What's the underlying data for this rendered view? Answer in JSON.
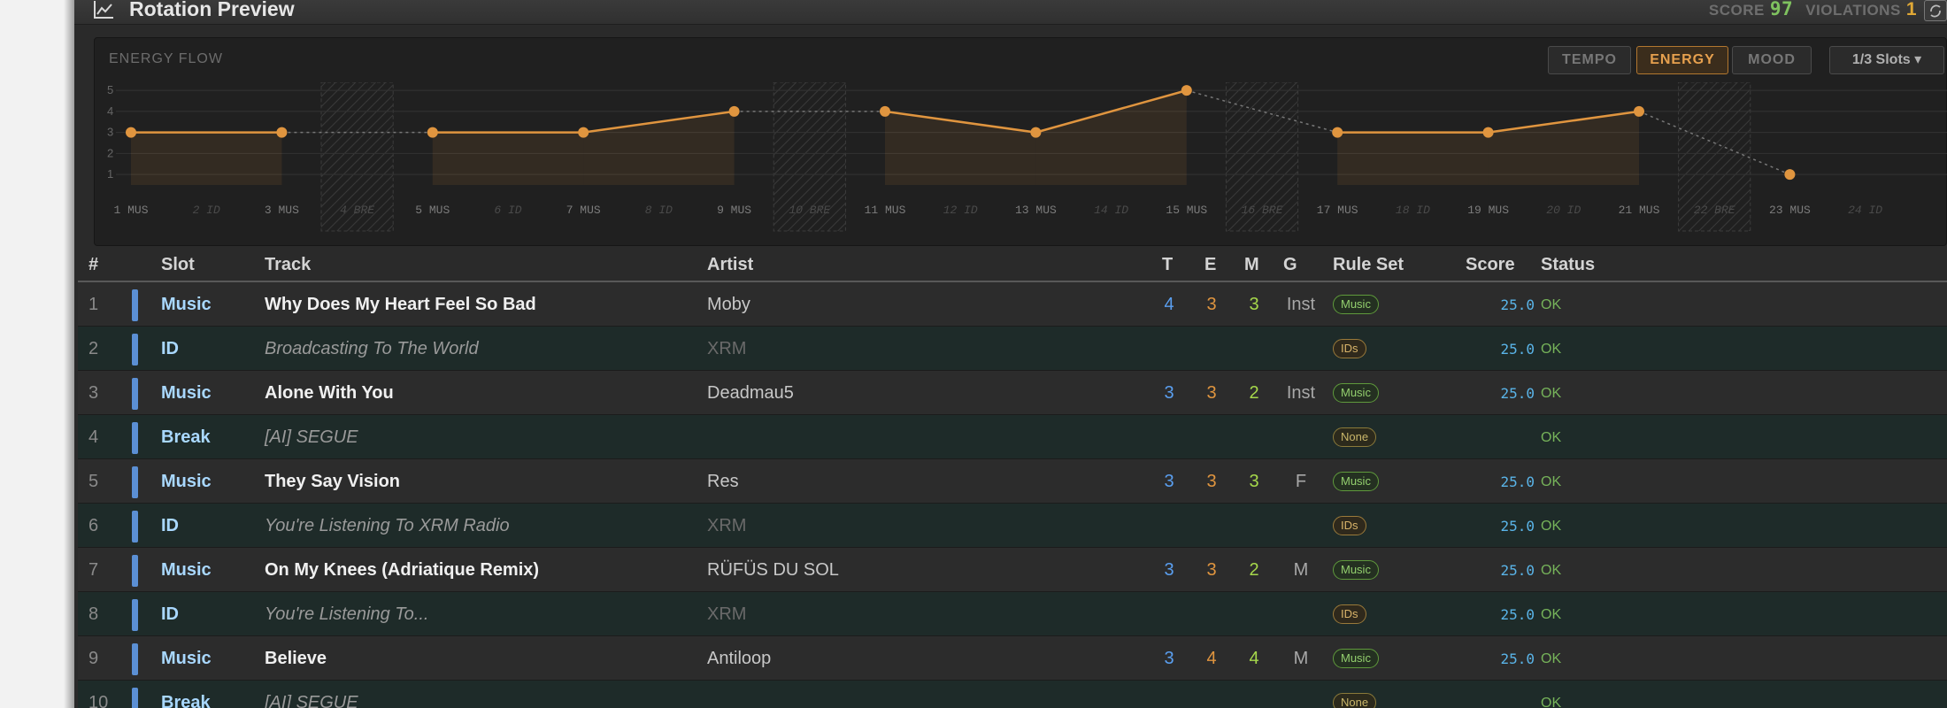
{
  "header": {
    "title": "Rotation Preview",
    "score_label": "SCORE",
    "score_value": "97",
    "violations_label": "VIOLATIONS",
    "violations_value": "1"
  },
  "chart_panel": {
    "label": "ENERGY FLOW",
    "toggles": [
      "TEMPO",
      "ENERGY",
      "MOOD"
    ],
    "active_toggle": "ENERGY",
    "slots_dropdown": "1/3 Slots ▾"
  },
  "chart_data": {
    "type": "line",
    "title": "",
    "xlabel": "",
    "ylabel": "",
    "ylim": [
      0.5,
      5.3
    ],
    "yticks": [
      1,
      2,
      3,
      4,
      5
    ],
    "grid": true,
    "x": [
      "1 MUS",
      "2 ID",
      "3 MUS",
      "4 BRE",
      "5 MUS",
      "6 ID",
      "7 MUS",
      "8 ID",
      "9 MUS",
      "10 BRE",
      "11 MUS",
      "12 ID",
      "13 MUS",
      "14 ID",
      "15 MUS",
      "16 BRE",
      "17 MUS",
      "18 ID",
      "19 MUS",
      "20 ID",
      "21 MUS",
      "22 BRE",
      "23 MUS",
      "24 ID"
    ],
    "series": [
      {
        "values": [
          3,
          null,
          3,
          null,
          3,
          null,
          3,
          null,
          4,
          null,
          4,
          null,
          3,
          null,
          5,
          null,
          3,
          null,
          3,
          null,
          4,
          null,
          1,
          null
        ]
      }
    ],
    "hatched_slots": [
      "4 BRE",
      "10 BRE",
      "16 BRE",
      "22 BRE"
    ],
    "line_color": "#e0953f"
  },
  "table": {
    "columns": [
      "#",
      "Slot",
      "Track",
      "Artist",
      "T",
      "E",
      "M",
      "G",
      "Rule Set",
      "Score",
      "Status"
    ],
    "rows": [
      {
        "n": "1",
        "slot": "Music",
        "track": "Why Does My Heart Feel So Bad",
        "artist": "Moby",
        "t": "4",
        "e": "3",
        "m": "3",
        "g": "Inst",
        "rule": "Music",
        "score": "25.0",
        "status": "OK"
      },
      {
        "n": "2",
        "slot": "ID",
        "track": "Broadcasting To The World",
        "artist": "XRM",
        "t": "",
        "e": "",
        "m": "",
        "g": "",
        "rule": "IDs",
        "score": "25.0",
        "status": "OK"
      },
      {
        "n": "3",
        "slot": "Music",
        "track": "Alone With You",
        "artist": "Deadmau5",
        "t": "3",
        "e": "3",
        "m": "2",
        "g": "Inst",
        "rule": "Music",
        "score": "25.0",
        "status": "OK"
      },
      {
        "n": "4",
        "slot": "Break",
        "track": "[AI] SEGUE",
        "artist": "",
        "t": "",
        "e": "",
        "m": "",
        "g": "",
        "rule": "None",
        "score": "",
        "status": "OK"
      },
      {
        "n": "5",
        "slot": "Music",
        "track": "They Say Vision",
        "artist": "Res",
        "t": "3",
        "e": "3",
        "m": "3",
        "g": "F",
        "rule": "Music",
        "score": "25.0",
        "status": "OK"
      },
      {
        "n": "6",
        "slot": "ID",
        "track": "You're Listening To XRM Radio",
        "artist": "XRM",
        "t": "",
        "e": "",
        "m": "",
        "g": "",
        "rule": "IDs",
        "score": "25.0",
        "status": "OK"
      },
      {
        "n": "7",
        "slot": "Music",
        "track": "On My Knees (Adriatique Remix)",
        "artist": "RÜFÜS DU SOL",
        "t": "3",
        "e": "3",
        "m": "2",
        "g": "M",
        "rule": "Music",
        "score": "25.0",
        "status": "OK"
      },
      {
        "n": "8",
        "slot": "ID",
        "track": "You're Listening To...",
        "artist": "XRM",
        "t": "",
        "e": "",
        "m": "",
        "g": "",
        "rule": "IDs",
        "score": "25.0",
        "status": "OK"
      },
      {
        "n": "9",
        "slot": "Music",
        "track": "Believe",
        "artist": "Antiloop",
        "t": "3",
        "e": "4",
        "m": "4",
        "g": "M",
        "rule": "Music",
        "score": "25.0",
        "status": "OK"
      },
      {
        "n": "10",
        "slot": "Break",
        "track": "[AI] SEGUE",
        "artist": "",
        "t": "",
        "e": "",
        "m": "",
        "g": "",
        "rule": "None",
        "score": "",
        "status": "OK"
      }
    ]
  }
}
